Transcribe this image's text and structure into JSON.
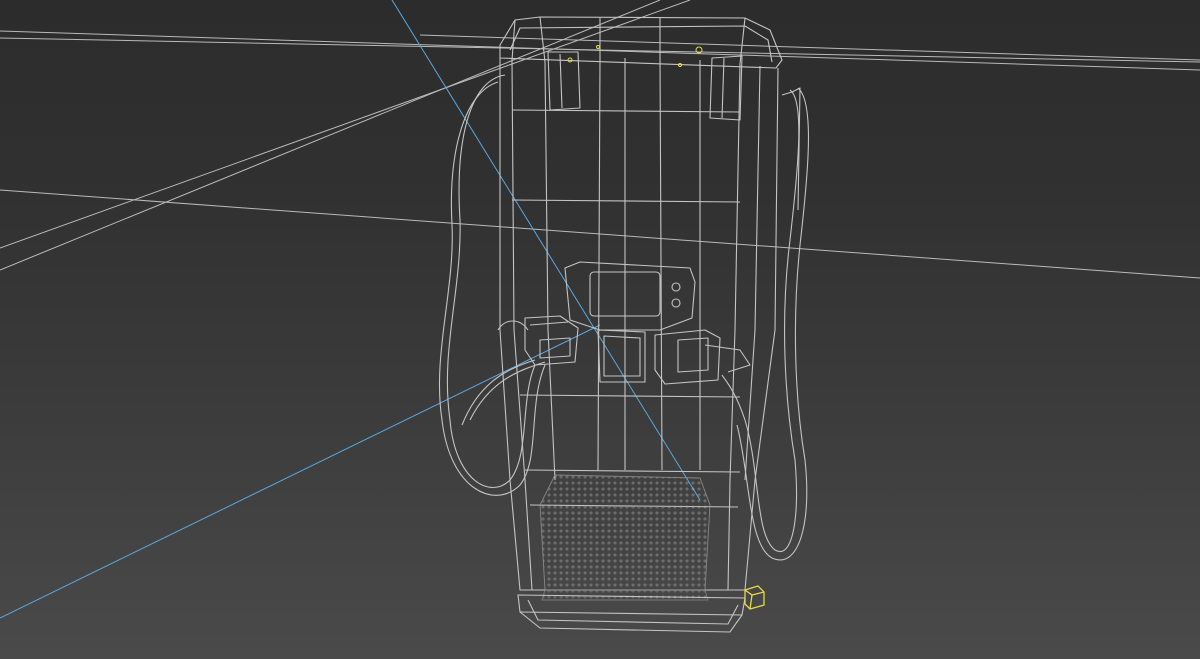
{
  "viewport": {
    "name": "3d-perspective-viewport",
    "display_mode": "wireframe",
    "model": "ev-charging-station-wireframe"
  },
  "colors": {
    "background_top": "#2c2c2c",
    "background_bottom": "#4a4a4a",
    "grid_line": "#cfcfcf",
    "wireframe": "#c4c4c4",
    "wireframe_dense": "#9c9c9c",
    "selection_axis": "#5aa7e0",
    "gizmo": "#e8d84a"
  }
}
